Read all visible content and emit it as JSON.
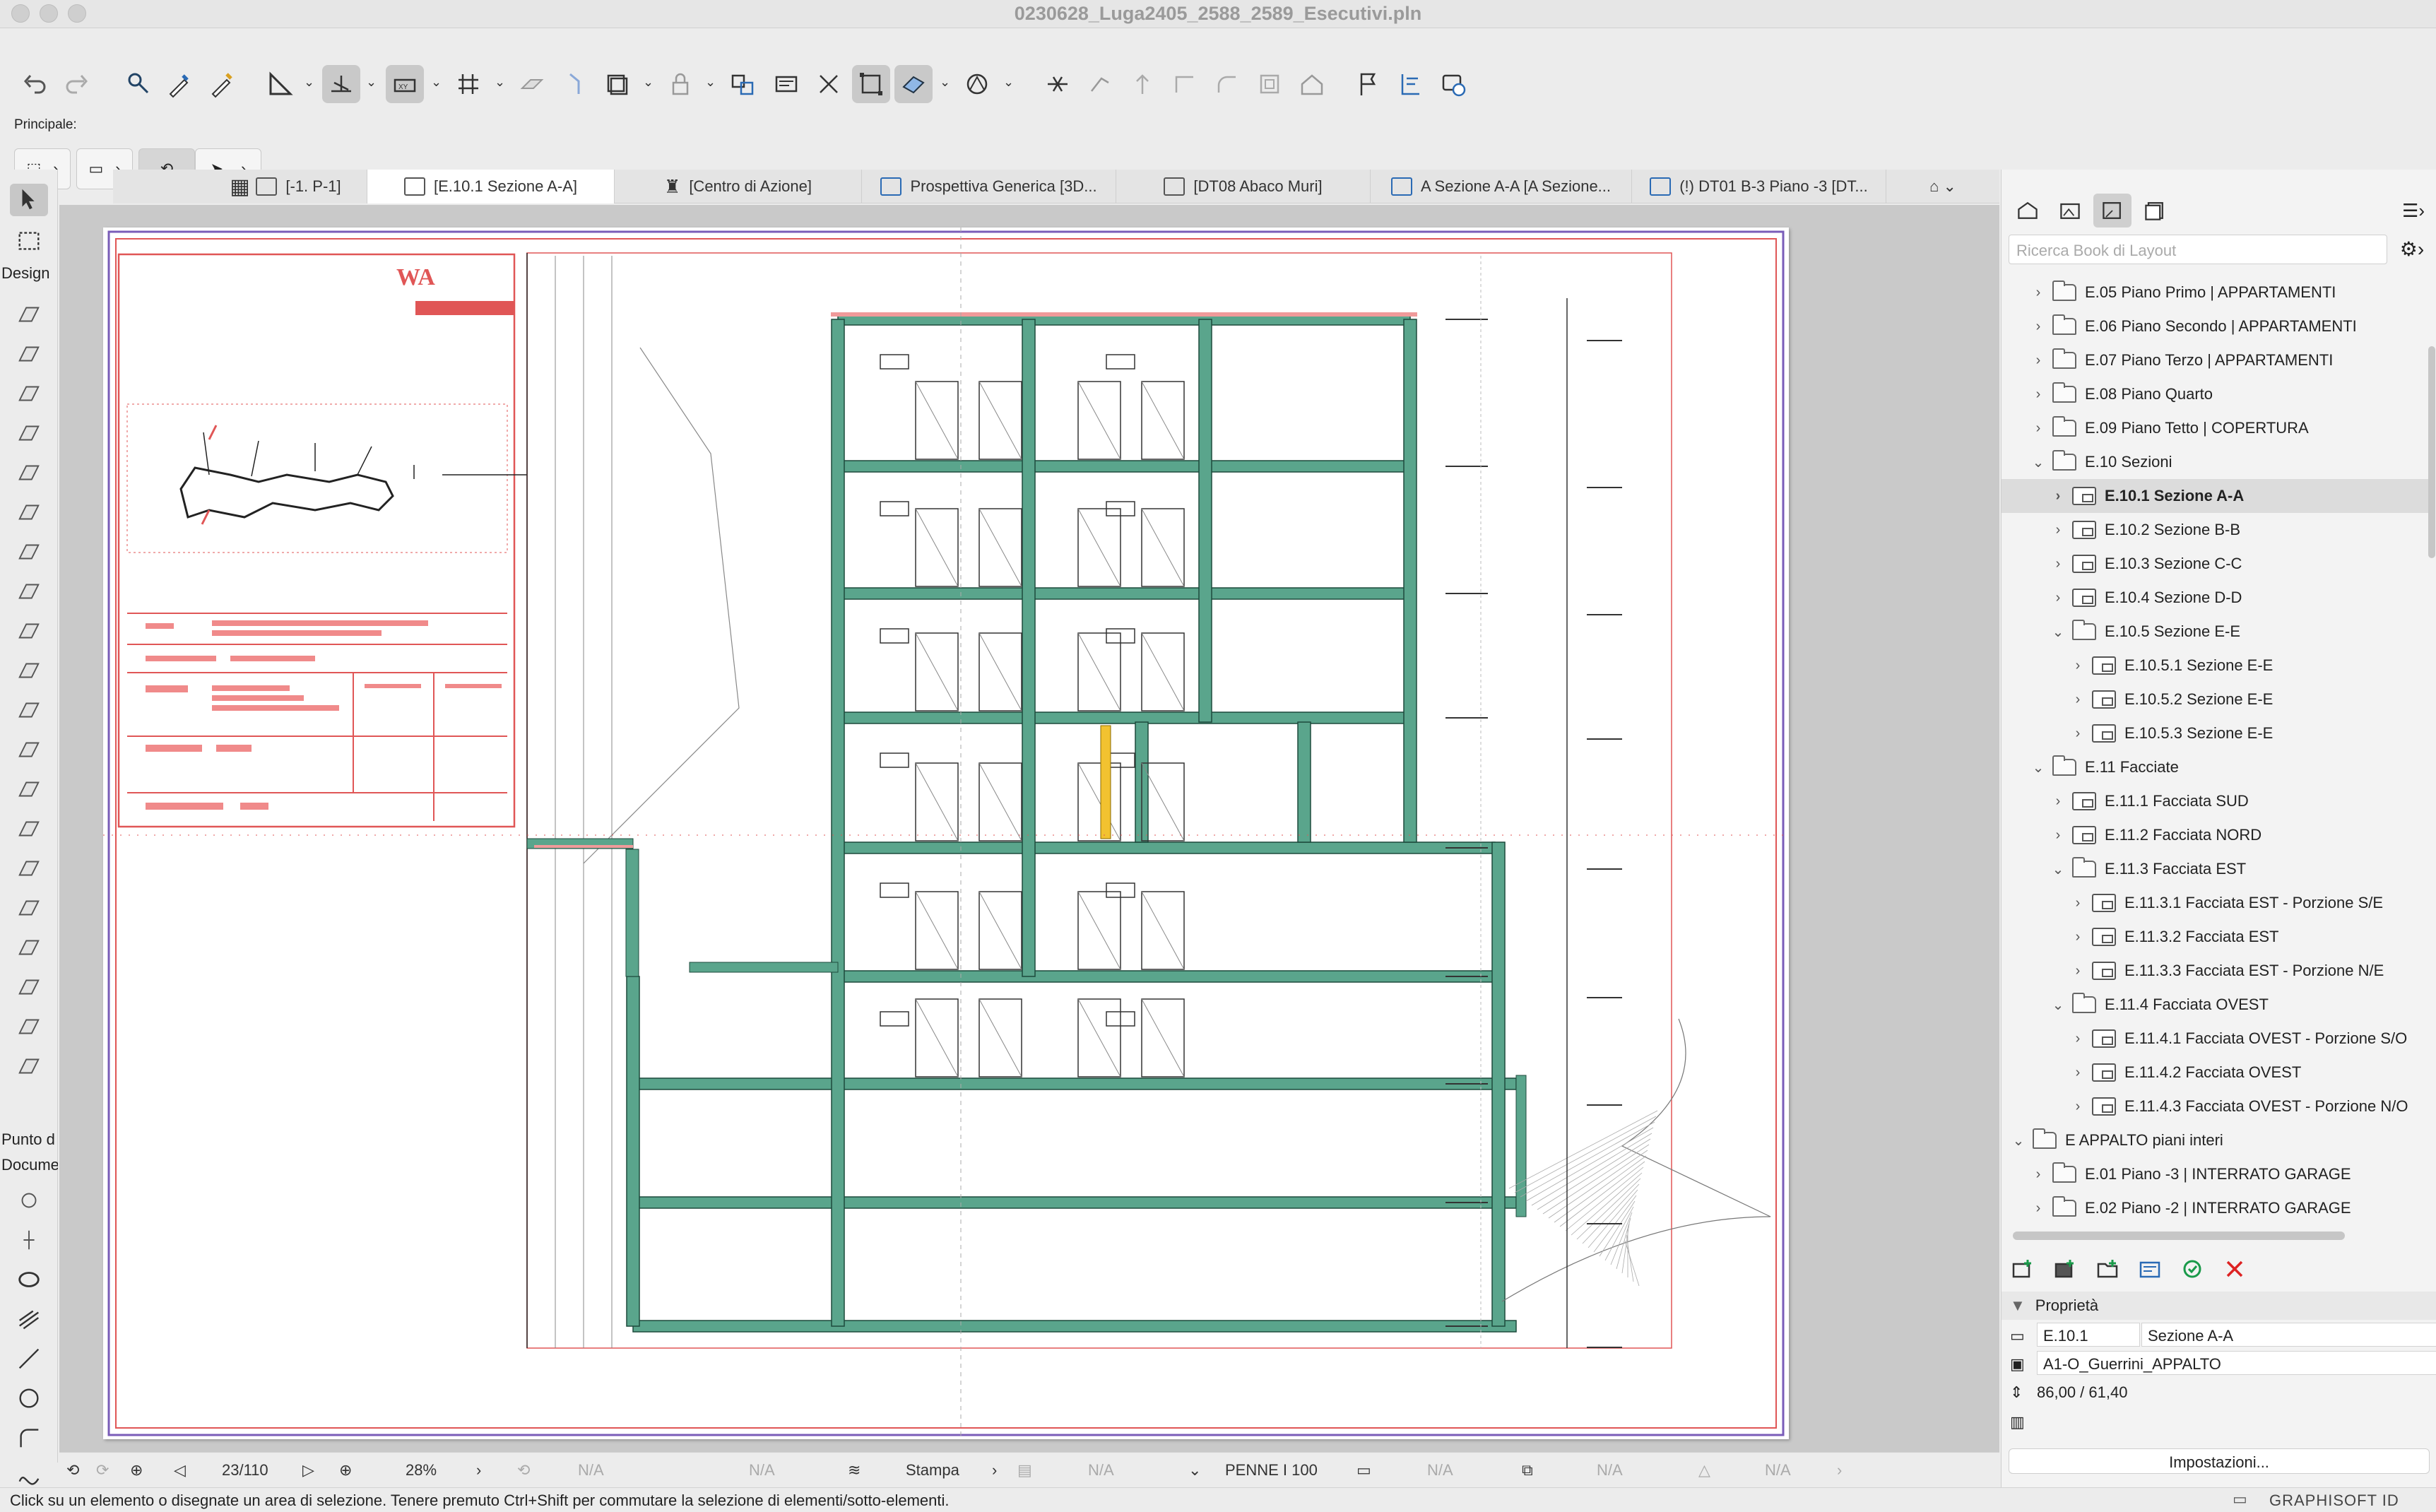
{
  "window": {
    "title": "0230628_Luga2405_2588_2589_Esecutivi.pln"
  },
  "toolbar": {
    "info_label": "Principale:",
    "icons": [
      "undo-icon",
      "redo-icon",
      "pick-up-icon",
      "eyedropper-icon",
      "inject-icon",
      "measure-icon",
      "snap-guide-icon",
      "relative-construction-icon",
      "grid-snap-icon",
      "gravity-icon",
      "pointer-icon",
      "layer-icon",
      "lock-icon",
      "group-icon",
      "renovation-icon",
      "show-sel-icon",
      "fit-window-icon",
      "model-3d-icon",
      "graphic-override-icon",
      "split-icon",
      "trim-icon",
      "elevate-icon",
      "intersect-icon",
      "fillet-icon",
      "offset-icon",
      "roof-icon",
      "flag-icon",
      "elevation-marker-icon",
      "teamwork-icon"
    ]
  },
  "tabs": [
    {
      "label": "[-1. P-1]"
    },
    {
      "label": "[E.10.1 Sezione A-A]"
    },
    {
      "label": "[Centro di Azione]"
    },
    {
      "label": "Prospettiva Generica [3D..."
    },
    {
      "label": "[DT08 Abaco Muri]"
    },
    {
      "label": "A Sezione A-A [A Sezione..."
    },
    {
      "label": "(!) DT01 B-3 Piano -3 [DT..."
    }
  ],
  "toolbox": {
    "design_label": "Design",
    "punto_label": "Punto d",
    "docu_label": "Docume",
    "tools": [
      "arrow-tool-icon",
      "marquee-tool-icon",
      "wall-tool-icon",
      "column-tool-icon",
      "beam-tool-icon",
      "slab-tool-icon",
      "roof-tool-icon",
      "shell-tool-icon",
      "stair-tool-icon",
      "railing-tool-icon",
      "curtain-wall-tool-icon",
      "door-tool-icon",
      "window-tool-icon",
      "skylight-tool-icon",
      "wall-end-tool-icon",
      "corner-window-tool-icon",
      "mesh-tool-icon",
      "morph-tool-icon",
      "object-tool-icon",
      "lamp-tool-icon",
      "zone-tool-icon",
      "opening-tool-icon"
    ]
  },
  "navigation": {
    "page": "23/110",
    "zoom": "28%",
    "na": "N/A",
    "pen_set_label": "Stampa",
    "pen_label": "PENNE I 100"
  },
  "status_text": "Click su un elemento o disegnate un area di selezione. Tenere premuto Ctrl+Shift per commutare la selezione di elementi/sotto-elementi.",
  "brand": "GRAPHISOFT ID",
  "navigator": {
    "search_placeholder": "Ricerca Book di Layout",
    "items": [
      {
        "label": "E.05 Piano Primo | APPARTAMENTI",
        "level": 1,
        "type": "folder",
        "open": false
      },
      {
        "label": "E.06 Piano Secondo | APPARTAMENTI",
        "level": 1,
        "type": "folder",
        "open": false
      },
      {
        "label": "E.07 Piano Terzo | APPARTAMENTI",
        "level": 1,
        "type": "folder",
        "open": false
      },
      {
        "label": "E.08 Piano Quarto",
        "level": 1,
        "type": "folder",
        "open": false
      },
      {
        "label": "E.09 Piano Tetto | COPERTURA",
        "level": 1,
        "type": "folder",
        "open": false
      },
      {
        "label": "E.10 Sezioni",
        "level": 1,
        "type": "folder",
        "open": true
      },
      {
        "label": "E.10.1 Sezione A-A",
        "level": 2,
        "type": "layout",
        "open": false,
        "selected": true
      },
      {
        "label": "E.10.2 Sezione B-B",
        "level": 2,
        "type": "layout",
        "open": false
      },
      {
        "label": "E.10.3 Sezione C-C",
        "level": 2,
        "type": "layout",
        "open": false
      },
      {
        "label": "E.10.4 Sezione D-D",
        "level": 2,
        "type": "layout",
        "open": false
      },
      {
        "label": "E.10.5 Sezione E-E",
        "level": 2,
        "type": "folder",
        "open": true
      },
      {
        "label": "E.10.5.1 Sezione E-E",
        "level": 3,
        "type": "layout",
        "open": false
      },
      {
        "label": "E.10.5.2 Sezione E-E",
        "level": 3,
        "type": "layout",
        "open": false
      },
      {
        "label": "E.10.5.3 Sezione E-E",
        "level": 3,
        "type": "layout",
        "open": false
      },
      {
        "label": "E.11 Facciate",
        "level": 1,
        "type": "folder",
        "open": true
      },
      {
        "label": "E.11.1 Facciata SUD",
        "level": 2,
        "type": "layout",
        "open": false
      },
      {
        "label": "E.11.2 Facciata NORD",
        "level": 2,
        "type": "layout",
        "open": false
      },
      {
        "label": "E.11.3 Facciata EST",
        "level": 2,
        "type": "folder",
        "open": true
      },
      {
        "label": "E.11.3.1 Facciata EST - Porzione S/E",
        "level": 3,
        "type": "layout",
        "open": false
      },
      {
        "label": "E.11.3.2 Facciata EST",
        "level": 3,
        "type": "layout",
        "open": false
      },
      {
        "label": "E.11.3.3 Facciata EST - Porzione N/E",
        "level": 3,
        "type": "layout",
        "open": false
      },
      {
        "label": "E.11.4 Facciata OVEST",
        "level": 2,
        "type": "folder",
        "open": true
      },
      {
        "label": "E.11.4.1 Facciata OVEST - Porzione S/O",
        "level": 3,
        "type": "layout",
        "open": false
      },
      {
        "label": "E.11.4.2 Facciata OVEST",
        "level": 3,
        "type": "layout",
        "open": false
      },
      {
        "label": "E.11.4.3 Facciata OVEST - Porzione N/O",
        "level": 3,
        "type": "layout",
        "open": false
      },
      {
        "label": "E APPALTO piani interi",
        "level": 0,
        "type": "folder",
        "open": true
      },
      {
        "label": "E.01 Piano -3 | INTERRATO GARAGE",
        "level": 1,
        "type": "folder",
        "open": false
      },
      {
        "label": "E.02 Piano -2 | INTERRATO GARAGE",
        "level": 1,
        "type": "folder",
        "open": false
      }
    ]
  },
  "properties": {
    "header": "Proprietà",
    "id": "E.10.1",
    "name": "Sezione A-A",
    "master": "A1-O_Guerrini_APPALTO",
    "size": "86,00 / 61,40",
    "settings_button": "Impostazioni..."
  },
  "sheet": {
    "logo_text": "WA",
    "accent_color": "#e35050",
    "wall_color": "#5aa58c"
  }
}
